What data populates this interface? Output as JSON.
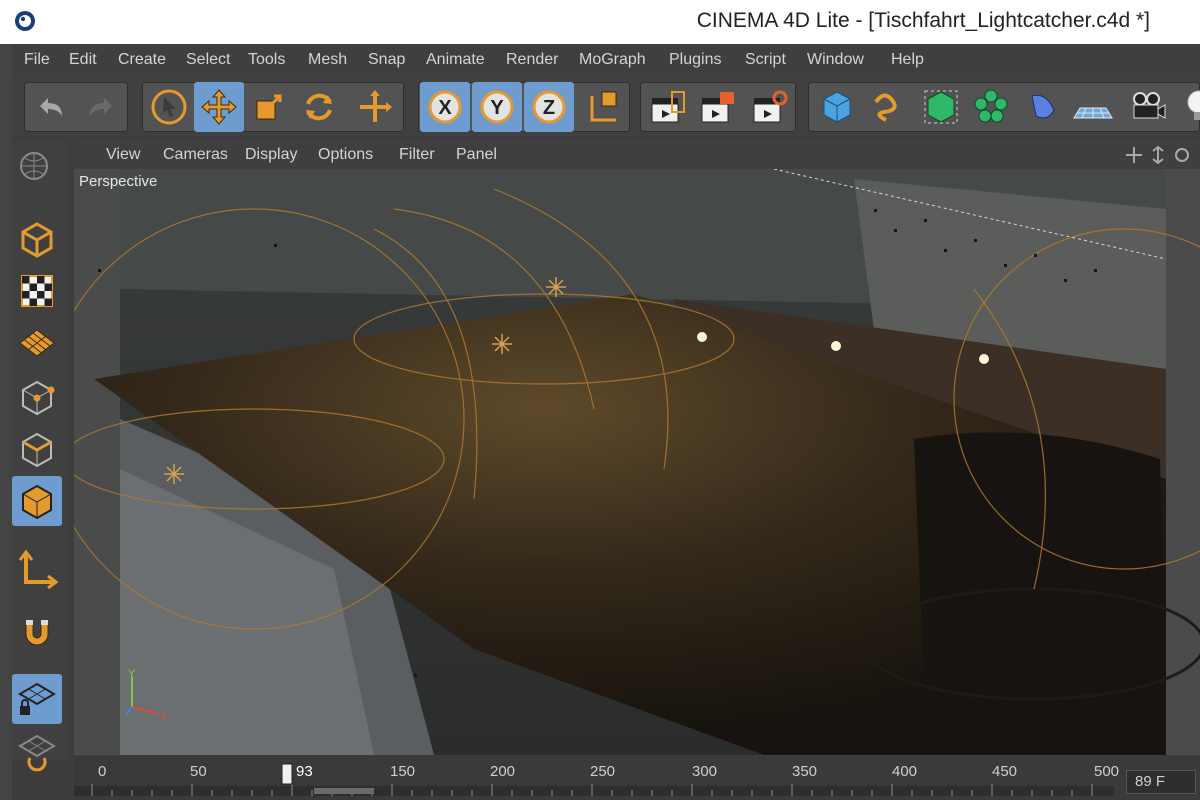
{
  "window": {
    "title": "CINEMA 4D Lite - [Tischfahrt_Lightcatcher.c4d *]"
  },
  "menubar": {
    "items": [
      "File",
      "Edit",
      "Create",
      "Select",
      "Tools",
      "Mesh",
      "Snap",
      "Animate",
      "Render",
      "MoGraph",
      "Plugins",
      "Script",
      "Window",
      "Help"
    ]
  },
  "viewport_menu": {
    "items": [
      "View",
      "Cameras",
      "Display",
      "Options",
      "Filter",
      "Panel"
    ]
  },
  "viewport": {
    "label": "Perspective",
    "axis_x": "X",
    "axis_y": "Y"
  },
  "timeline": {
    "ticks": [
      "0",
      "50",
      "150",
      "200",
      "250",
      "300",
      "350",
      "400",
      "450",
      "500"
    ],
    "current_frame_label": "93",
    "frame_field": "89 F"
  },
  "colors": {
    "accent": "#e59a2e",
    "selected": "#6e9ccf"
  }
}
